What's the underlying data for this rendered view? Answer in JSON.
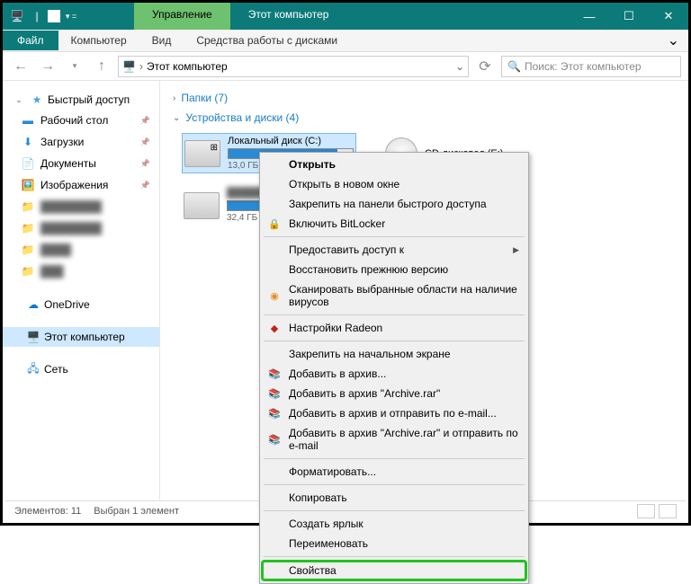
{
  "titlebar": {
    "tab_manage": "Управление",
    "tab_main": "Этот компьютер"
  },
  "ribbon": {
    "file": "Файл",
    "computer": "Компьютер",
    "view": "Вид",
    "disk_tools": "Средства работы с дисками"
  },
  "address": {
    "location": "Этот компьютер",
    "search_placeholder": "Поиск: Этот компьютер"
  },
  "sidebar": {
    "quick_access": "Быстрый доступ",
    "desktop": "Рабочий стол",
    "downloads": "Загрузки",
    "documents": "Документы",
    "pictures": "Изображения",
    "onedrive": "OneDrive",
    "this_pc": "Этот компьютер",
    "network": "Сеть"
  },
  "content": {
    "folders_header": "Папки (7)",
    "devices_header": "Устройства и диски (4)",
    "drive_c": {
      "name": "Локальный диск (C:)",
      "free": "13,0 ГБ",
      "fill_pct": 88
    },
    "drive_e": {
      "name": "CD-дисковод (E:)"
    },
    "drive_d_free": "32,4 ГБ"
  },
  "context": {
    "open": "Открыть",
    "open_new": "Открыть в новом окне",
    "pin_quick": "Закрепить на панели быстрого доступа",
    "bitlocker": "Включить BitLocker",
    "share_access": "Предоставить доступ к",
    "restore_prev": "Восстановить прежнюю версию",
    "scan_virus": "Сканировать выбранные области на наличие вирусов",
    "radeon": "Настройки Radeon",
    "pin_start": "Закрепить на начальном экране",
    "add_archive": "Добавить в архив...",
    "add_archive_rar": "Добавить в архив \"Archive.rar\"",
    "add_send_mail": "Добавить в архив и отправить по e-mail...",
    "add_rar_send_mail": "Добавить в архив \"Archive.rar\" и отправить по e-mail",
    "format": "Форматировать...",
    "copy": "Копировать",
    "create_shortcut": "Создать ярлык",
    "rename": "Переименовать",
    "properties": "Свойства"
  },
  "status": {
    "elements": "Элементов: 11",
    "selected": "Выбран 1 элемент"
  }
}
